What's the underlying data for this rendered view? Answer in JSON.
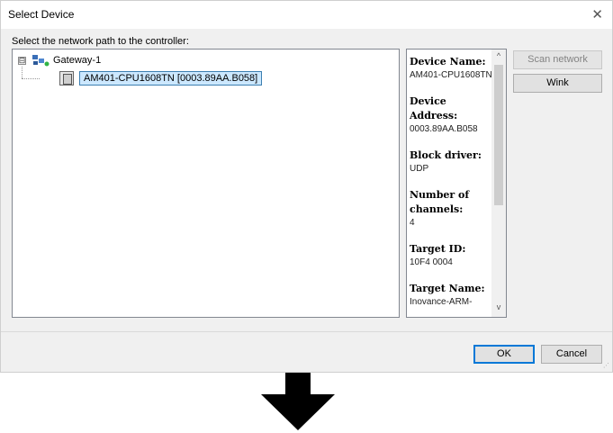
{
  "window": {
    "title": "Select Device",
    "close_glyph": "✕"
  },
  "prompt": "Select the network path to the controller:",
  "tree": {
    "gateway": {
      "expander": "⊟",
      "label": "Gateway-1",
      "icon": "network-gateway-icon"
    },
    "device": {
      "label": "AM401-CPU1608TN [0003.89AA.B058]",
      "icon": "plc-device-icon"
    }
  },
  "info": {
    "items": [
      {
        "label": "Device Name:",
        "value": "AM401-CPU1608TN"
      },
      {
        "label": "Device Address:",
        "value": "0003.89AA.B058"
      },
      {
        "label": "Block driver:",
        "value": "UDP"
      },
      {
        "label": "Number of channels:",
        "value": "4"
      },
      {
        "label": "Target ID:",
        "value": "10F4 0004"
      },
      {
        "label": "Target Name:",
        "value": "Inovance-ARM-"
      }
    ],
    "scroll_up": "^",
    "scroll_down": "v"
  },
  "buttons": {
    "scan_network": "Scan network",
    "wink": "Wink",
    "ok": "OK",
    "cancel": "Cancel"
  },
  "colors": {
    "selection": "#cce8ff",
    "accent": "#0078d7",
    "arrow": "#000000"
  }
}
